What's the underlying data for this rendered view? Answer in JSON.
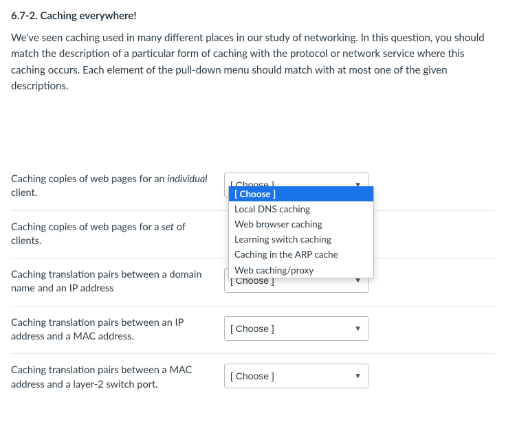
{
  "question": {
    "title": "6.7-2. Caching everywhere!",
    "body": "We've seen caching used in many different places in our study of networking.  In this question, you should match the description of a particular form of caching with the protocol or network service where this caching occurs. Each element of the pull-down menu should match with at most one of the given descriptions."
  },
  "choose_label": "[ Choose ]",
  "rows": [
    {
      "desc_html": "Caching copies of web pages for an <em>individual</em> client."
    },
    {
      "desc_html": "Caching copies of web pages for a <em>set</em> of clients."
    },
    {
      "desc_html": "Caching translation pairs between a domain name and an IP address"
    },
    {
      "desc_html": "Caching translation pairs between an IP address and a MAC address."
    },
    {
      "desc_html": "Caching translation pairs between a MAC address and a layer-2 switch port."
    }
  ],
  "dropdown_options": [
    "[ Choose ]",
    "Local DNS caching",
    "Web browser caching",
    "Learning switch caching",
    "Caching in the ARP cache",
    "Web caching/proxy"
  ],
  "dropdown_selected_index": 0,
  "dropdown_open_row_index": 1
}
